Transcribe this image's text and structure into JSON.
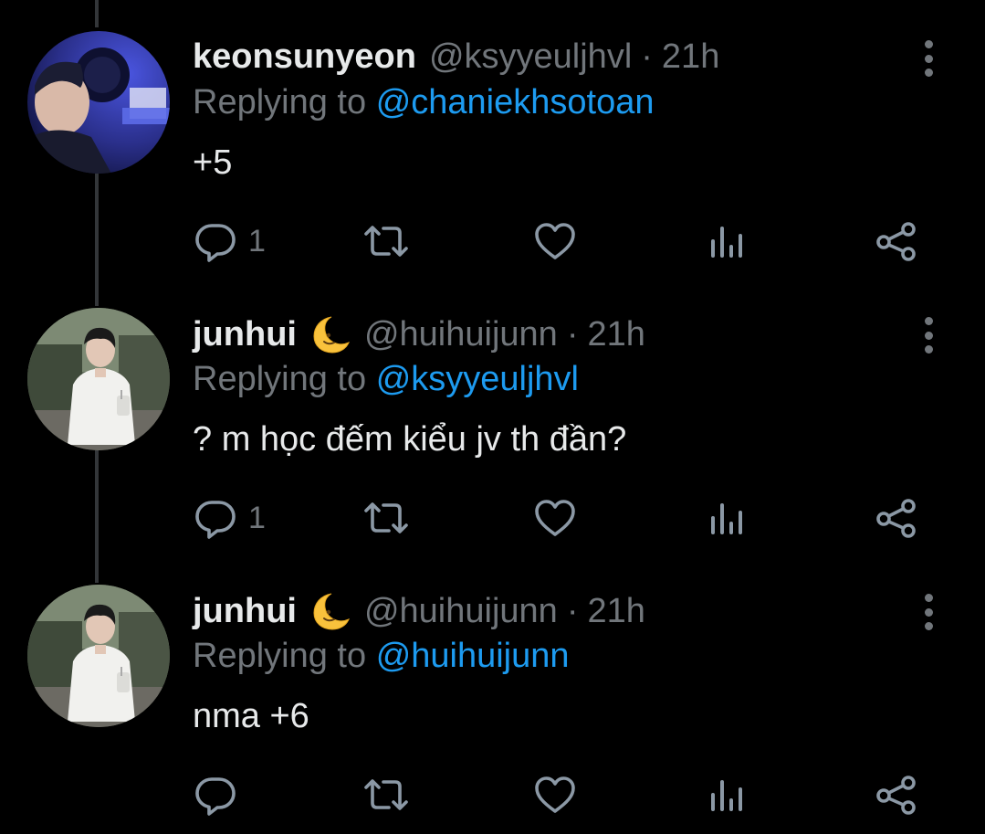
{
  "tweets": [
    {
      "name": "keonsunyeon",
      "emoji_icon": "",
      "handle": "@ksyyeuljhvl",
      "separator": "·",
      "time": "21h",
      "replying_prefix": "Replying to",
      "replying_to": "@chaniekhsotoan",
      "text": "+5",
      "reply_count": "1"
    },
    {
      "name": "junhui",
      "emoji_icon": "crescent-moon-face-icon",
      "handle": "@huihuijunn",
      "separator": "·",
      "time": "21h",
      "replying_prefix": "Replying to",
      "replying_to": "@ksyyeuljhvl",
      "text": "? m học đếm kiểu jv th đần?",
      "reply_count": "1"
    },
    {
      "name": "junhui",
      "emoji_icon": "crescent-moon-face-icon",
      "handle": "@huihuijunn",
      "separator": "·",
      "time": "21h",
      "replying_prefix": "Replying to",
      "replying_to": "@huihuijunn",
      "text": "nma +6",
      "reply_count": ""
    }
  ],
  "icons": {
    "reply": "reply-icon",
    "retweet": "retweet-icon",
    "like": "heart-icon",
    "views": "views-icon",
    "share": "share-icon",
    "more": "more-vertical-icon"
  },
  "colors": {
    "background": "#000000",
    "primary_text": "#e7e9ea",
    "secondary_text": "#71767b",
    "mention": "#1d9bf0",
    "thread_line": "#333639"
  }
}
